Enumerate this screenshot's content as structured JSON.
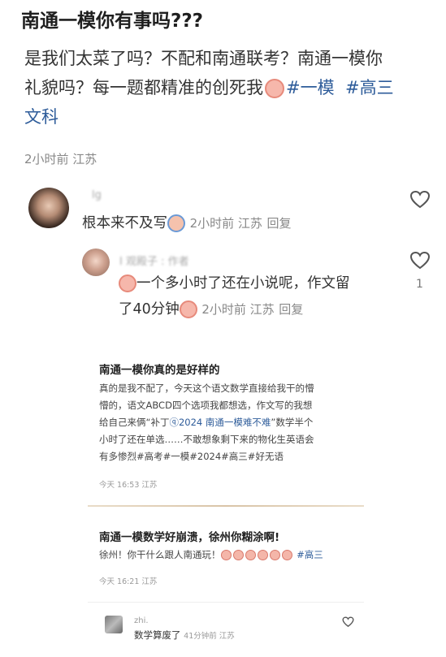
{
  "post": {
    "title": "南通一模你有事吗???",
    "body_line1": "是我们太菜了吗？不配和南通联考？南通一模你",
    "body_line2_text": "礼貌吗？每一题都精准的创死我",
    "tag1": "#一模",
    "tag2": "#高三",
    "tag2_cont": "文科",
    "meta": "2小时前 江苏"
  },
  "comments": [
    {
      "username": "lg",
      "text": "根本来不及写",
      "meta": "2小时前 江苏",
      "reply": "回复",
      "emoji": "crying-face-icon"
    },
    {
      "username": "I 观殿子  :  作者",
      "text_line1": "一个多小时了还在小说呢，作文留",
      "text_line2": "了40分钟",
      "meta": "2小时前 江苏",
      "reply": "回复",
      "like_count": "1"
    }
  ],
  "embedded": {
    "post1": {
      "title": "南通一模你真的是好样的",
      "line1": "真的是我不配了，今天这个语文数学直接给我干的懵",
      "line2": "懵的，语文ABCD四个选项我都想选，作文写的我想",
      "line3a": "给自己来俩“补丁",
      "line3_link": "2024 南通一模难不难",
      "line3b": "”数学半个",
      "line4": "小时了还在单选……不敢想象剩下来的物化生英语会",
      "line5": "有多惨烈#高考#一模#2024#高三#好无语",
      "meta": "今天 16:53 江苏"
    },
    "post2": {
      "title": "南通一模数学好崩溃，徐州你糊涂啊!",
      "body": "徐州！你干什么跟人南通玩！",
      "tag": "#高三",
      "meta": "今天 16:21 江苏"
    },
    "comment": {
      "username": "zhi.",
      "text": "数学算废了",
      "meta": "41分钟前 江苏"
    }
  },
  "colors": {
    "accent_tag": "#2e5c9a",
    "meta_gray": "#888888"
  }
}
